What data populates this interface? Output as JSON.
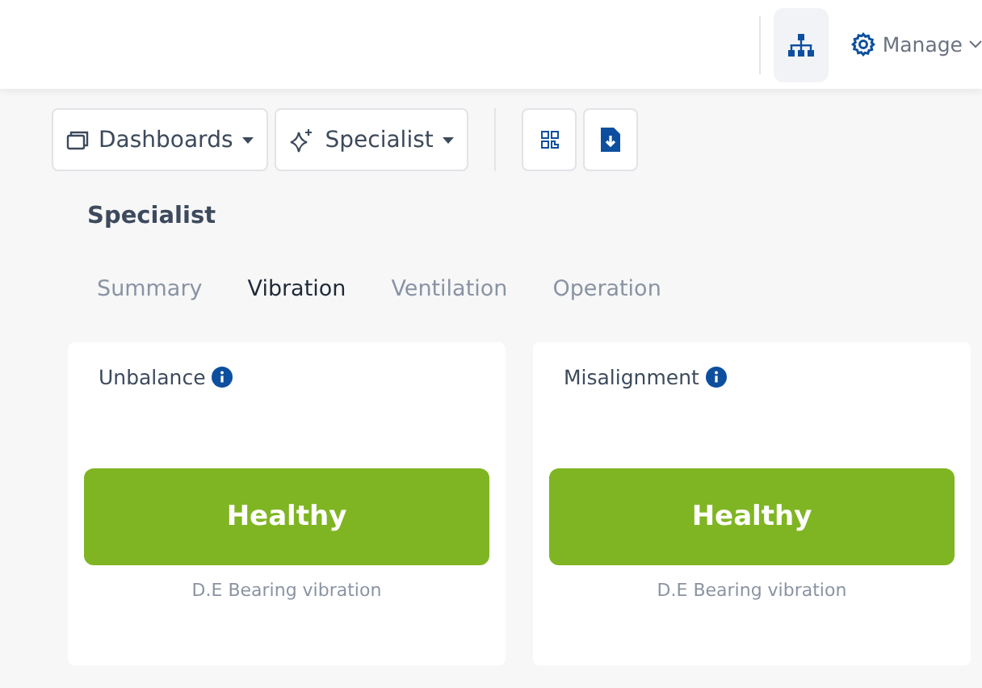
{
  "header": {
    "manage_label": "Manage"
  },
  "toolbar": {
    "dropdowns": [
      {
        "kind": "dashboards",
        "label": "Dashboards"
      },
      {
        "kind": "specialist",
        "label": "Specialist"
      }
    ]
  },
  "section_title": "Specialist",
  "tabs": [
    {
      "label": "Summary",
      "selected": false
    },
    {
      "label": "Vibration",
      "selected": true
    },
    {
      "label": "Ventilation",
      "selected": false
    },
    {
      "label": "Operation",
      "selected": false
    }
  ],
  "cards": [
    {
      "title": "Unbalance",
      "status": {
        "label": "Healthy",
        "kind": "healthy"
      },
      "caption": "D.E Bearing vibration"
    },
    {
      "title": "Misalignment",
      "status": {
        "label": "Healthy",
        "kind": "healthy"
      },
      "caption": "D.E Bearing vibration"
    }
  ]
}
